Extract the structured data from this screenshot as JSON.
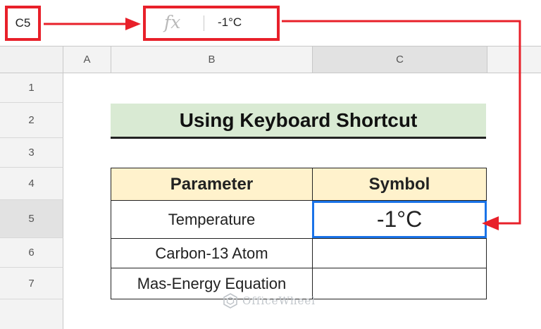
{
  "formula_bar": {
    "name_box": "C5",
    "fx_icon": "fx",
    "value": "-1°C"
  },
  "columns": [
    "A",
    "B",
    "C"
  ],
  "rows": [
    "1",
    "2",
    "3",
    "4",
    "5",
    "6",
    "7"
  ],
  "sheet": {
    "title": "Using Keyboard Shortcut",
    "table": {
      "headers": [
        "Parameter",
        "Symbol"
      ],
      "rows": [
        {
          "parameter": "Temperature",
          "symbol": "-1°C"
        },
        {
          "parameter": "Carbon-13 Atom",
          "symbol": ""
        },
        {
          "parameter": "Mas-Energy Equation",
          "symbol": ""
        }
      ]
    }
  },
  "watermark": "OfficeWheel",
  "colors": {
    "annotation": "#e8202a",
    "selection": "#1a73e8",
    "title_fill": "#d9ead3",
    "header_fill": "#fff2cc"
  },
  "icons": [
    "fx-icon",
    "arrow-icon",
    "officewheel-logo-icon"
  ]
}
